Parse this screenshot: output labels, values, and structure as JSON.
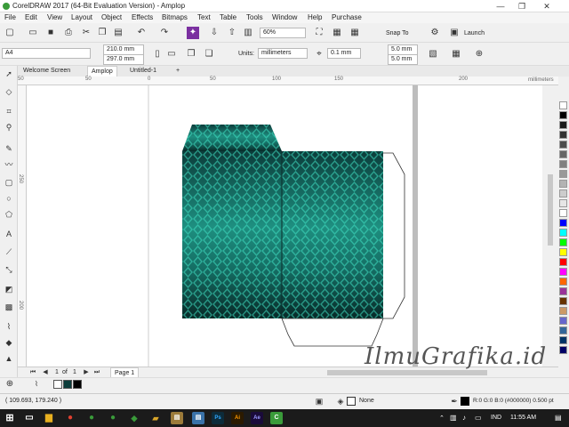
{
  "window": {
    "title": "CorelDRAW 2017 (64-Bit Evaluation Version) - Amplop",
    "minimize": "—",
    "maximize": "❐",
    "close": "✕"
  },
  "menu": [
    "File",
    "Edit",
    "View",
    "Layout",
    "Object",
    "Effects",
    "Bitmaps",
    "Text",
    "Table",
    "Tools",
    "Window",
    "Help",
    "Purchase"
  ],
  "toolbar": {
    "zoom": "60%",
    "snap_to": "Snap To",
    "launch": "Launch"
  },
  "property_bar": {
    "page_size": "A4",
    "width": "210.0 mm",
    "height": "297.0 mm",
    "units_label": "Units:",
    "units": "millimeters",
    "nudge": "0.1 mm",
    "dup_x": "5.0 mm",
    "dup_y": "5.0 mm"
  },
  "tabs": [
    {
      "label": "Welcome Screen"
    },
    {
      "label": "Amplop"
    },
    {
      "label": "Untitled-1"
    },
    {
      "label": "+"
    }
  ],
  "ruler": {
    "h_ticks": [
      "50",
      "0",
      "50",
      "100",
      "150",
      "200"
    ],
    "units": "millimeters",
    "v_ticks": [
      "250",
      "200"
    ]
  },
  "page_nav": {
    "current": "1",
    "of_label": "of",
    "total": "1",
    "page_tab": "Page 1"
  },
  "status": {
    "cursor": "( 109.693, 179.240 )",
    "fill": "None",
    "outline": "R:0 G:0 B:0 (#000000)  0.500 pt"
  },
  "taskbar": {
    "lang": "IND",
    "time": "11:55 AM"
  },
  "watermark": "IlmuGrafika.id",
  "palette_colors": [
    "#ffffff",
    "#000000",
    "#1a1a1a",
    "#333333",
    "#4d4d4d",
    "#666666",
    "#808080",
    "#999999",
    "#b3b3b3",
    "#cccccc",
    "#e6e6e6",
    "#ffffff",
    "#0000ff",
    "#00ffff",
    "#00ff00",
    "#ffff00",
    "#ff0000",
    "#ff00ff",
    "#ff6600",
    "#993399",
    "#663300",
    "#cc9966",
    "#6666cc",
    "#336699",
    "#003366",
    "#000066"
  ],
  "colors": {
    "envelope_dark": "#0c3d3b",
    "envelope_light": "#2ec4a8",
    "accent": "#1a73c8"
  }
}
